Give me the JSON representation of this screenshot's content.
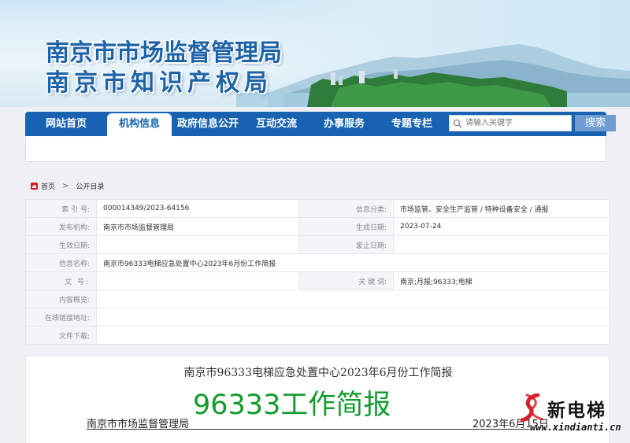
{
  "header": {
    "title_line1": "南京市市场监督管理局",
    "title_line2": "南京市知识产权局"
  },
  "nav": {
    "items": [
      {
        "label": "网站首页",
        "active": false
      },
      {
        "label": "机构信息",
        "active": true
      },
      {
        "label": "政府信息公开",
        "active": false
      },
      {
        "label": "互动交流",
        "active": false
      },
      {
        "label": "办事服务",
        "active": false
      },
      {
        "label": "专题专栏",
        "active": false
      }
    ],
    "search_placeholder": "请输入关键字",
    "search_button": "搜索"
  },
  "breadcrumb": {
    "home": "首页",
    "separator": ">",
    "current": "公开目录"
  },
  "meta": {
    "rows": [
      {
        "k1": "索 引 号:",
        "v1": "000014349/2023-64156",
        "k2": "信息分类:",
        "v2": "市场监管、安全生产监管 / 特种设备安全 / 通报"
      },
      {
        "k1": "发布机构:",
        "v1": "南京市市场监督管理局",
        "k2": "生成日期:",
        "v2": "2023-07-24"
      },
      {
        "k1": "生效日期:",
        "v1": "",
        "k2": "废止日期:",
        "v2": ""
      },
      {
        "k1": "信息名称:",
        "v1": "南京市96333电梯应急处置中心2023年6月份工作简报",
        "k2": null,
        "v2": null
      },
      {
        "k1": "文    号:",
        "v1": "",
        "k2": "关 键 词:",
        "v2": "南京;月报;96333;电梯"
      },
      {
        "k1": "内容概览:",
        "v1": "",
        "k2": null,
        "v2": null
      },
      {
        "k1": "在线链接地址:",
        "v1": "",
        "k2": null,
        "v2": null
      },
      {
        "k1": "文件下载:",
        "v1": "",
        "k2": null,
        "v2": null
      }
    ]
  },
  "article": {
    "title": "南京市96333电梯应急处置中心2023年6月份工作简报",
    "headline": "96333工作简报",
    "org": "南京市市场监督管理局",
    "date": "2023年6月15日"
  },
  "watermark": {
    "text": "新电梯",
    "url": "www.xindianti.cn"
  },
  "colors": {
    "nav_blue": "#1763b1",
    "title_blue": "#1e63a8",
    "headline_green": "#139b2e",
    "search_button": "#6f9cd3",
    "brand_red": "#d4212b"
  }
}
